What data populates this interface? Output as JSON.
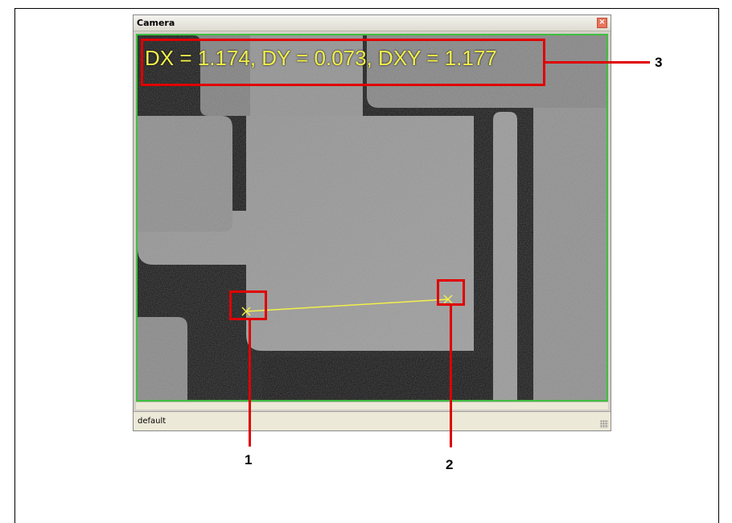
{
  "window": {
    "title": "Camera",
    "close_symbol": "×",
    "status_text": "default"
  },
  "measurement": {
    "readout": "DX = 1.174, DY = 0.073, DXY = 1.177"
  },
  "callouts": {
    "point1": "1",
    "point2": "2",
    "readout": "3"
  },
  "colors": {
    "measurement": "#f3f04a",
    "callout": "#e00000",
    "frame": "#3fbf3f"
  },
  "icons": {
    "close": "close-icon",
    "marker": "crosshair-x-icon",
    "resize": "resize-grip-icon"
  }
}
